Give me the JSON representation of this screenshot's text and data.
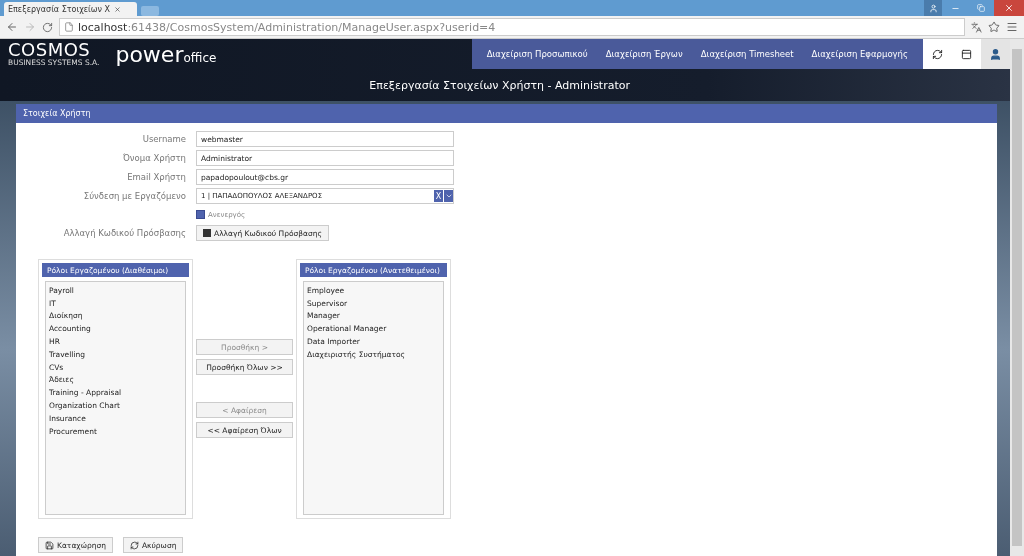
{
  "browser": {
    "tab_title": "Επεξεργασία Στοιχείων Χ",
    "url_host": "localhost",
    "url_rest": ":61438/CosmosSystem/Administration/ManageUser.aspx?userid=4"
  },
  "header": {
    "logo": "COSMOS",
    "logo_sub": "BUSINESS SYSTEMS S.A.",
    "product": "power",
    "product_suffix": "office",
    "title": "Επεξεργασία Στοιχείων Χρήστη - Administrator",
    "nav": [
      {
        "label": "Διαχείριση Προσωπικού"
      },
      {
        "label": "Διαχείριση Έργων"
      },
      {
        "label": "Διαχείριση Timesheet"
      },
      {
        "label": "Διαχείριση Εφαρμογής"
      }
    ]
  },
  "panel": {
    "title": "Στοιχεία Χρήστη",
    "fields": [
      {
        "label": "Username",
        "value": "webmaster",
        "kind": "text"
      },
      {
        "label": "Όνομα Χρήστη",
        "value": "Administrator",
        "kind": "text"
      },
      {
        "label": "Email Χρήστη",
        "value": "papadopoulout@cbs.gr",
        "kind": "text"
      },
      {
        "label": "Σύνδεση με Εργαζόμενο",
        "value": "1 | ΠΑΠΑΔΟΠΟΥΛΟΣ ΑΛΕΞΑΝΔΡΟΣ",
        "kind": "combo",
        "clear": "X"
      }
    ],
    "inactive": {
      "label": "Ανενεργός",
      "checked": false
    },
    "password": {
      "label": "Αλλαγή Κωδικού Πρόσβασης",
      "button": "Αλλαγή Κωδικού Πρόσβασης"
    },
    "available": {
      "title": "Ρόλοι Εργαζομένου (Διαθέσιμοι)",
      "items": [
        "Payroll",
        "IT",
        "Διοίκηση",
        "Accounting",
        "HR",
        "Travelling",
        "CVs",
        "Άδειες",
        "Training - Appraisal",
        "Organization Chart",
        "Insurance",
        "Procurement"
      ]
    },
    "assigned": {
      "title": "Ρόλοι Εργαζομένου (Ανατεθειμένοι)",
      "items": [
        "Employee",
        "Supervisor",
        "Manager",
        "Operational Manager",
        "Data Importer",
        "Διαχειριστής Συστήματος"
      ]
    },
    "move_buttons": [
      {
        "label": "Προσθήκη >",
        "disabled": true
      },
      {
        "label": "Προσθήκη Όλων >>",
        "disabled": false
      },
      {
        "label": "< Αφαίρεση",
        "disabled": true
      },
      {
        "label": "<< Αφαίρεση Όλων",
        "disabled": false
      }
    ],
    "actions": [
      {
        "label": "Καταχώρηση",
        "kind": "save"
      },
      {
        "label": "Ακύρωση",
        "kind": "cancel"
      }
    ]
  }
}
